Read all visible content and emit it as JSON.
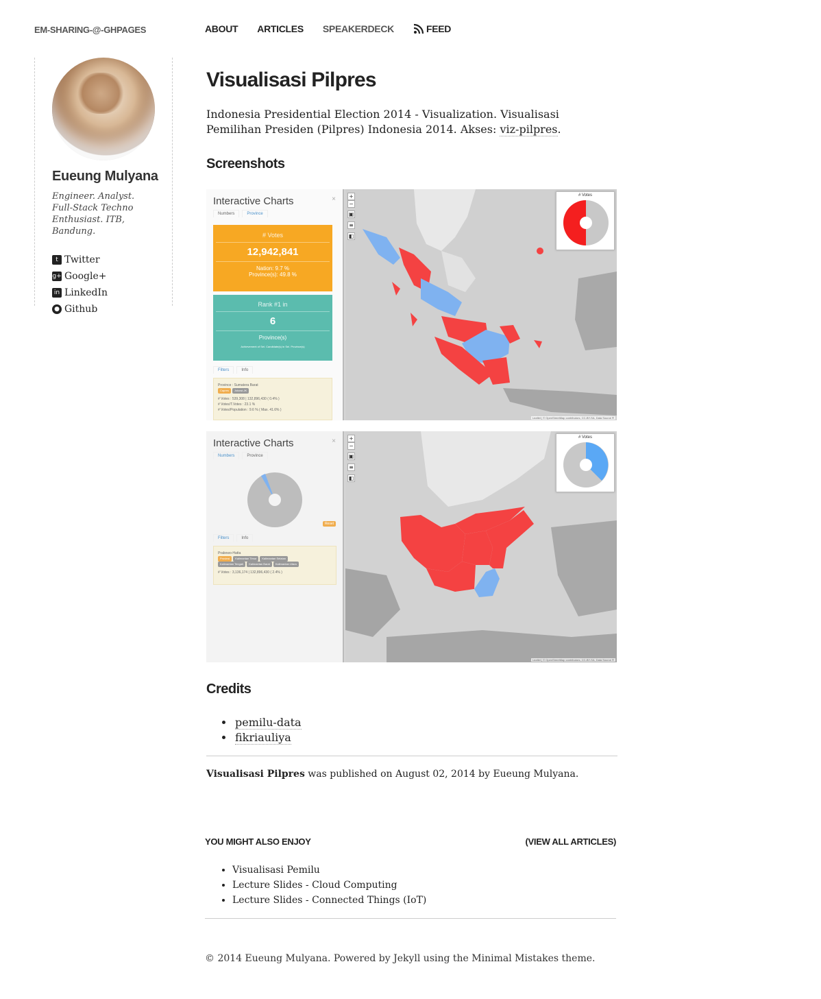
{
  "site": {
    "title": "EM-SHARING-@-GHPAGES",
    "nav": [
      "ABOUT",
      "ARTICLES",
      "SPEAKERDECK",
      "FEED"
    ]
  },
  "author": {
    "name": "Eueung Mulyana",
    "bio": "Engineer. Analyst. Full-Stack Techno Enthusiast. ITB, Bandung.",
    "social": [
      {
        "label": "Twitter",
        "icon": "twitter-icon"
      },
      {
        "label": "Google+",
        "icon": "google-plus-icon"
      },
      {
        "label": "LinkedIn",
        "icon": "linkedin-icon"
      },
      {
        "label": "Github",
        "icon": "github-icon"
      }
    ]
  },
  "post": {
    "title": "Visualisasi Pilpres",
    "intro": "Indonesia Presidential Election 2014 - Visualization. Visualisasi Pemilihan Presiden (Pilpres) Indonesia 2014. Akses: ",
    "intro_link": "viz-pilpres",
    "intro_end": ".",
    "screenshots_heading": "Screenshots",
    "credits_heading": "Credits",
    "credits": [
      "pemilu-data",
      "fikriauliya"
    ],
    "published_title": "Visualisasi Pilpres",
    "published_text": " was published on August 02, 2014 by Eueung Mulyana."
  },
  "shot1": {
    "panel_title": "Interactive Charts",
    "close": "×",
    "tabs": [
      "Numbers",
      "Province"
    ],
    "votes_label": "# Votes",
    "votes_value": "12,942,841",
    "nation_line": "Nation: 9.7 %",
    "province_line": "Province(s): 49.8 %",
    "rank_label": "Rank #1 in",
    "rank_value": "6",
    "rank_unit": "Province(s)",
    "rank_note": "Achievement of Sel. Candidate(s) in Sel. Province(s)",
    "tabs2": [
      "Filters",
      "Info"
    ],
    "info_province": "Province : Sumatera Barat",
    "info_tags": [
      "Capres",
      "Jokowi-JK"
    ],
    "info_lines": [
      "# Votes : 539,308 | 132,896,430 ( 0.4% )",
      "# Votes/T.Votes : 23.1 %",
      "# Votes/Population : 9.6 % ( Max. 41.6% )"
    ],
    "mini_title": "# Votes",
    "attrib": "Leaflet | © OpenStreetMap contributors, CC-BY-SA, Data Source ®"
  },
  "shot2": {
    "panel_title": "Interactive Charts",
    "close": "×",
    "tabs": [
      "Numbers",
      "Province"
    ],
    "reset": "Reset",
    "tabs2": [
      "Filters",
      "Info"
    ],
    "info_title": "Prabowo-Hatta",
    "info_tags": [
      "Provinsi",
      "Kalimantan Timur",
      "Kalimantan Selatan",
      "Kalimantan Tengah",
      "Kalimantan Barat",
      "Kalimantan Utara"
    ],
    "info_line": "# Votes : 3,136,174 | 132,896,430 ( 2.4% )",
    "mini_title": "# Votes",
    "attrib": "Leaflet | © OpenStreetMap contributors, CC-BY-SA, Data Source ®"
  },
  "related": {
    "heading": "YOU MIGHT ALSO ENJOY",
    "view_all": "(VIEW ALL ARTICLES)",
    "items": [
      "Visualisasi Pemilu",
      "Lecture Slides - Cloud Computing",
      "Lecture Slides - Connected Things (IoT)"
    ]
  },
  "footer": {
    "text": "© 2014 Eueung Mulyana. Powered by Jekyll using the Minimal Mistakes theme."
  },
  "colors": {
    "red": "#f44242",
    "blue": "#7fb2f0",
    "orange": "#f7a823",
    "teal": "#5bbcae"
  }
}
